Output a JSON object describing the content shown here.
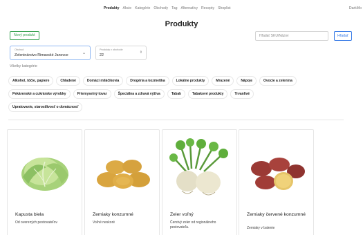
{
  "nav": {
    "links": [
      "Produkty",
      "Akcie",
      "Kategórie",
      "Obchody",
      "Tag",
      "Alternatívy",
      "Recepty",
      "Shoplist"
    ],
    "right": "DarkMo"
  },
  "page": {
    "title": "Produkty"
  },
  "toolbar": {
    "new_product": "Nový produkt",
    "search_placeholder": "Hľadať SKU/Názov",
    "search_button": "Hľadať"
  },
  "filters": {
    "store_label": "Obchod",
    "store_value": "Zeleninárstvo Rimavské Janovce",
    "count_label": "Produkty v obchode",
    "count_value": "22",
    "all_categories": "Všetky kategórie"
  },
  "categories": [
    [
      "Alkohol, tóčie, papiere",
      "Chladené",
      "Domáci miláčikovia",
      "Drogéria a kozmetika",
      "Lokálne produkty",
      "Mrazené",
      "Nápoje",
      "Ovocie a zelenina"
    ],
    [
      "Pekárenské a cukrárske výrobky",
      "Priemyselný tovar",
      "Špeciálna a zdravá výživa",
      "Tabak",
      "Tabakové produkty",
      "Trvanlivé"
    ],
    [
      "Upratovanie, starostlivosť o domácnosť"
    ]
  ],
  "products": [
    {
      "name": "Kapusta biela",
      "desc": "Od overených pestovateľov",
      "image": "cabbage"
    },
    {
      "name": "Zemiaky konzumné",
      "desc": "Voľné neskoré",
      "image": "potatoes"
    },
    {
      "name": "Zeler voľný",
      "desc": "Čerstvý zeler od regionálneho pestovateľa.",
      "image": "celeriac"
    },
    {
      "name": "Zemiaky červené konzumné",
      "desc": "Zemiaky v balenie",
      "image": "red-potatoes"
    }
  ]
}
